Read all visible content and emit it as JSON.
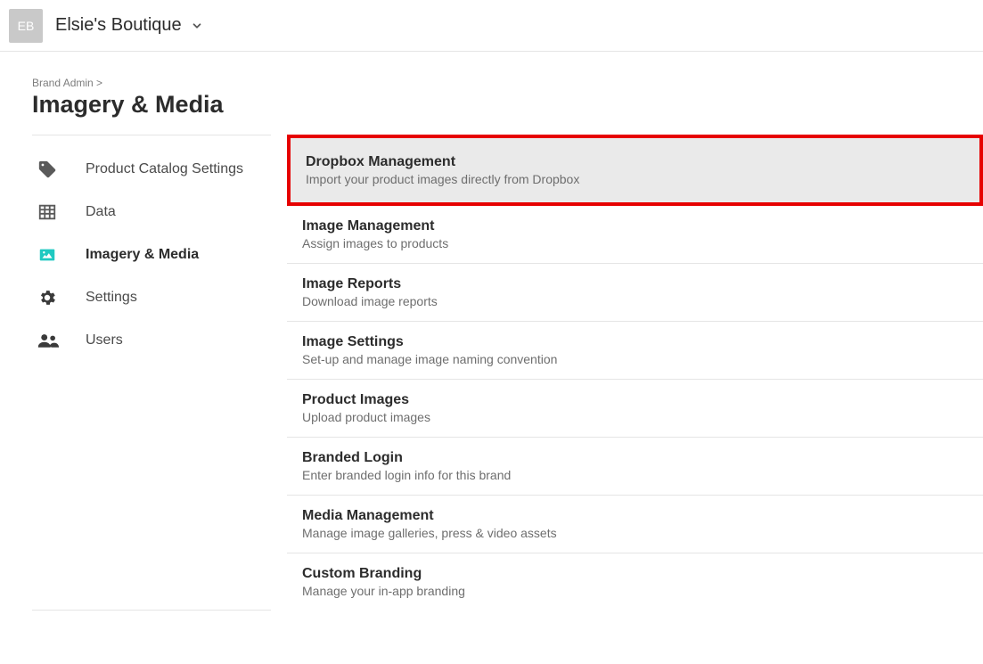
{
  "header": {
    "brand_initials": "EB",
    "brand_name": "Elsie's Boutique"
  },
  "breadcrumb": "Brand Admin >",
  "page_title": "Imagery & Media",
  "sidebar": {
    "items": [
      {
        "label": "Product Catalog Settings",
        "icon": "tag-icon",
        "active": false
      },
      {
        "label": "Data",
        "icon": "grid-icon",
        "active": false
      },
      {
        "label": "Imagery & Media",
        "icon": "image-icon",
        "active": true
      },
      {
        "label": "Settings",
        "icon": "gear-icon",
        "active": false
      },
      {
        "label": "Users",
        "icon": "users-icon",
        "active": false
      }
    ]
  },
  "main": {
    "items": [
      {
        "title": "Dropbox Management",
        "desc": "Import your product images directly from Dropbox",
        "highlighted": true
      },
      {
        "title": "Image Management",
        "desc": "Assign images to products",
        "highlighted": false
      },
      {
        "title": "Image Reports",
        "desc": "Download image reports",
        "highlighted": false
      },
      {
        "title": "Image Settings",
        "desc": "Set-up and manage image naming convention",
        "highlighted": false
      },
      {
        "title": "Product Images",
        "desc": "Upload product images",
        "highlighted": false
      },
      {
        "title": "Branded Login",
        "desc": "Enter branded login info for this brand",
        "highlighted": false
      },
      {
        "title": "Media Management",
        "desc": "Manage image galleries, press & video assets",
        "highlighted": false
      },
      {
        "title": "Custom Branding",
        "desc": "Manage your in-app branding",
        "highlighted": false
      }
    ]
  },
  "colors": {
    "accent": "#1fc9c1",
    "highlight_border": "#e60000"
  }
}
